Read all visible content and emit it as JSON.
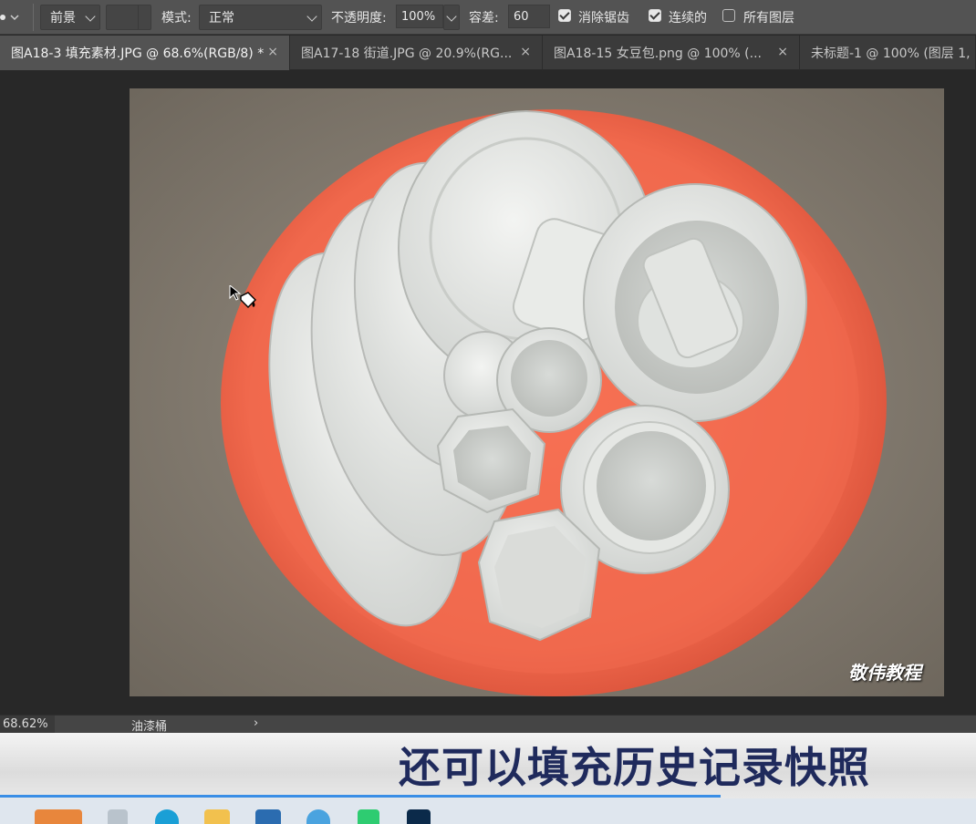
{
  "options_bar": {
    "fill_source": "前景",
    "mode_label": "模式:",
    "mode_value": "正常",
    "opacity_label": "不透明度:",
    "opacity_value": "100%",
    "tolerance_label": "容差:",
    "tolerance_value": "60",
    "antialias_label": "消除锯齿",
    "antialias_checked": true,
    "contiguous_label": "连续的",
    "contiguous_checked": true,
    "all_layers_label": "所有图层",
    "all_layers_checked": false
  },
  "tabs": [
    {
      "label": "图A18-3 填充素材.JPG @ 68.6%(RGB/8) *",
      "active": true
    },
    {
      "label": "图A17-18 街道.JPG @ 20.9%(RG...",
      "active": false
    },
    {
      "label": "图A18-15 女豆包.png @ 100% (...",
      "active": false
    },
    {
      "label": "未标题-1 @ 100% (图层 1,",
      "active": false
    }
  ],
  "watermark": "敬伟教程",
  "status": {
    "zoom": "68.62%",
    "tool_name": "油漆桶",
    "arrow": "›"
  },
  "caption": "还可以填充历史记录快照",
  "colors": {
    "basin": "#f0684c",
    "caption_text": "#1f2a5c",
    "progress_line": "#3a8ee6"
  }
}
